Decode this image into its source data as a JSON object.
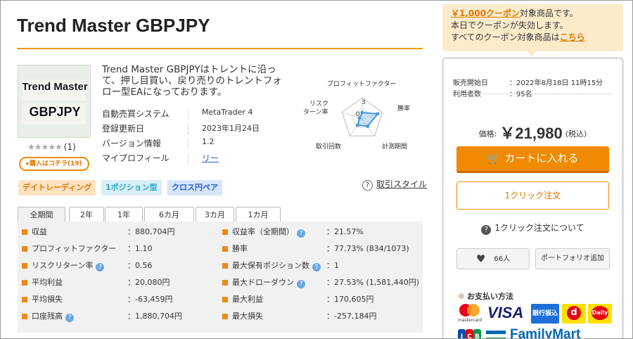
{
  "product": {
    "title": "Trend Master GBPJPY",
    "thumb_line1": "Trend Master",
    "thumb_line2": "GBPJPY",
    "stars": "★★★★★",
    "review_count": "(1)",
    "buyers_badge": "▸購入はコチラ(19)",
    "description": "Trend Master GBPJPYはトレントに沿って、押し目買い、戻り売りのトレントフォロー型EAになっております。",
    "info": [
      {
        "label": "自動売買システム",
        "value": "MetaTrader 4"
      },
      {
        "label": "登録更新日",
        "value": "2023年1月24日"
      },
      {
        "label": "バージョン情報",
        "value": "1.2"
      },
      {
        "label": "マイプロフィール",
        "value": "リー"
      }
    ]
  },
  "radar": {
    "labels": {
      "top": "プロフィットファクター",
      "top_right": "勝率",
      "bottom_right": "計測期間",
      "bottom_left": "取引回数",
      "top_left_1": "リスク",
      "top_left_2": "ターン率"
    },
    "scale_max": "3",
    "scale_zero": "0",
    "values": [
      0.9,
      2.3,
      1.3,
      1.1,
      0.4
    ],
    "max": 3,
    "colors": {
      "fill": "#9cc8ec",
      "stroke": "#4b98d9",
      "grid": "#bbbbbb"
    }
  },
  "tags": [
    {
      "label": "デイトレーディング",
      "bg": "#fde2c2",
      "fg": "#e07800"
    },
    {
      "label": "1ポジション型",
      "bg": "#d8f0f6",
      "fg": "#2aa6c9"
    },
    {
      "label": "クロス円ペア",
      "bg": "#d6e6fa",
      "fg": "#2a5bd7"
    }
  ],
  "risk_style": {
    "icon": "?",
    "label": "取引スタイル"
  },
  "tabs": [
    "全期間",
    "2年",
    "1年",
    "6カ月",
    "3カ月",
    "1カ月"
  ],
  "stats": {
    "left": [
      {
        "label": "収益",
        "value": "：880,704円",
        "hint": false
      },
      {
        "label": "プロフィットファクター",
        "value": "：1.10",
        "hint": false
      },
      {
        "label": "リスクリターン率",
        "value": "：0.56",
        "hint": true
      },
      {
        "label": "平均利益",
        "value": "：20,080円",
        "hint": false
      },
      {
        "label": "平均損失",
        "value": "：-63,459円",
        "hint": false
      },
      {
        "label": "口座残高",
        "value": "：1,880,704円",
        "hint": true
      }
    ],
    "right": [
      {
        "label": "収益率（全期間）",
        "value": "：21.57%",
        "hint": true
      },
      {
        "label": "勝率",
        "value": "：77.73% (834/1073)",
        "hint": false
      },
      {
        "label": "最大保有ポジション数",
        "value": "：1",
        "hint": true
      },
      {
        "label": "最大ドローダウン",
        "value": "：27.53% (1,581,440円)",
        "hint": true
      },
      {
        "label": "最大利益",
        "value": "：170,605円",
        "hint": false
      },
      {
        "label": "最大損失",
        "value": "：-257,184円",
        "hint": false
      }
    ],
    "hint_icon": "?"
  },
  "coupon": {
    "link_text": "￥1,000クーポン",
    "line1_rest": "対象商品です。",
    "line2": "本日でクーポンが失効します。",
    "line3_pre": "すべてのクーポン対象商品は",
    "line3_link": "こちら"
  },
  "sidebar": {
    "release_label": "販売開始日",
    "release_value": "：2022年8月18日 11時15分",
    "users_label": "利用者数",
    "users_value": "：95名",
    "price_label": "価格:",
    "price_value": "￥21,980",
    "price_tax": "(税込)",
    "cart_label": "カートに入れる",
    "oneclick_label": "1クリック注文",
    "about_icon": "?",
    "about_label": "1クリック注文について",
    "like_count": "66人",
    "portfolio_label": "ポートフォリオ追加",
    "payment_title": "お支払い方法",
    "payments": {
      "mastercard": "mastercard",
      "visa": "VISA",
      "bank": "銀行振込",
      "dpay": "d",
      "daily": "Daily",
      "jcb": [
        "J",
        "C",
        "B"
      ],
      "familymart": "FamilyMart"
    }
  },
  "colors": {
    "accent": "#f08a00",
    "link": "#2a5bd7",
    "stat_marker": "#e98a1c",
    "hint": "#6aa6e3"
  }
}
